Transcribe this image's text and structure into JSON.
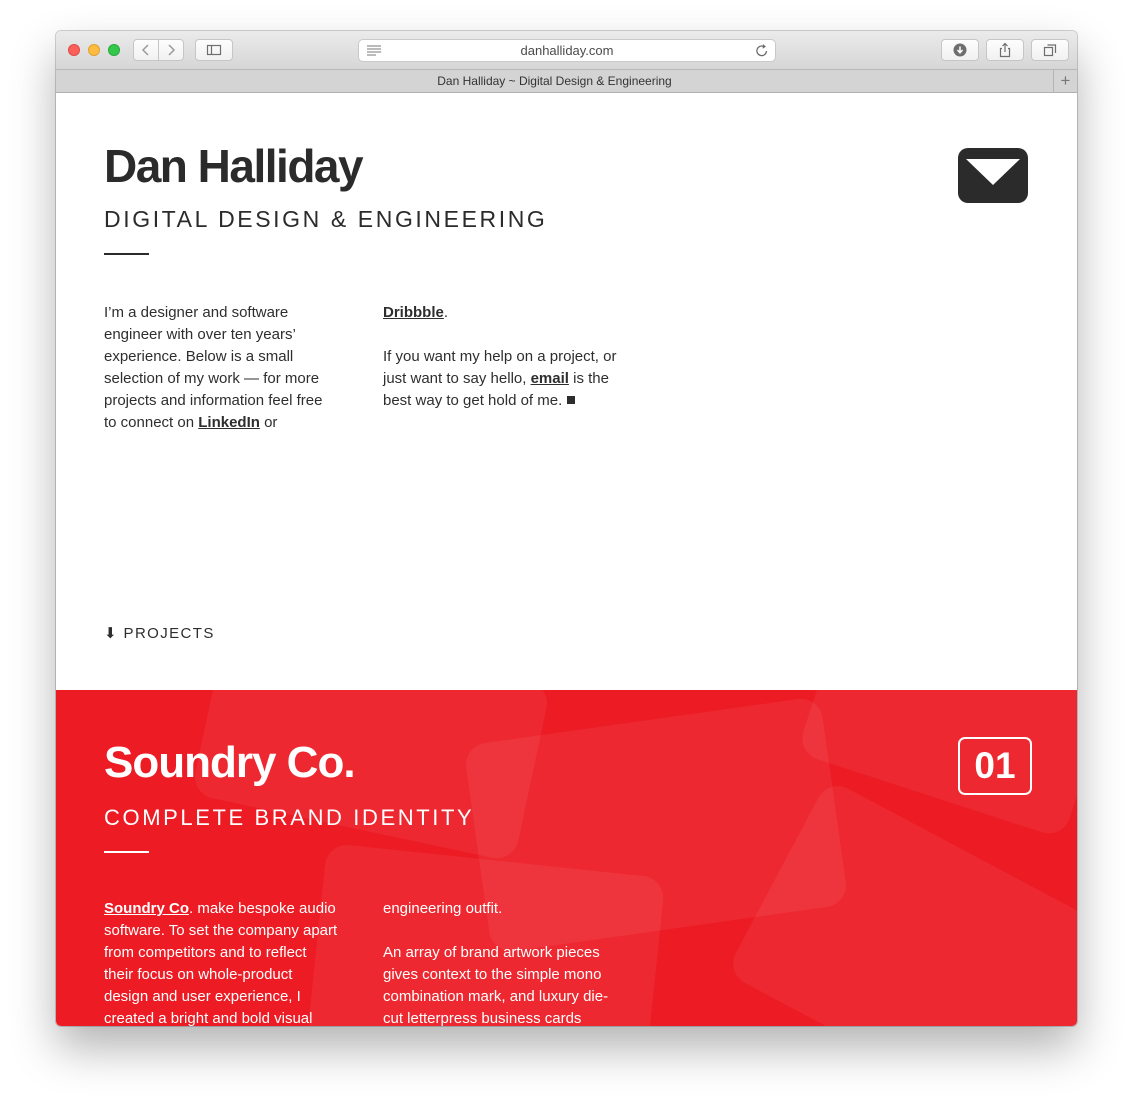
{
  "browser": {
    "url": "danhalliday.com",
    "tab_title": "Dan Halliday ~ Digital Design & Engineering",
    "new_tab_label": "+"
  },
  "header": {
    "name": "Dan Halliday",
    "subtitle": "DIGITAL DESIGN & ENGINEERING"
  },
  "intro": {
    "col1_text": "I’m a designer and software engineer with over ten years’ experience. Below is a small selection of my work — for more projects and information feel free to connect on ",
    "linkedin_label": "LinkedIn",
    "or_text": " or",
    "dribbble_label": "Dribbble",
    "period": ".",
    "contact_pre": "If you want my help on a project, or just want to say hello, ",
    "email_label": "email",
    "contact_post": " is the best way to get hold of me."
  },
  "projects_link": {
    "arrow": "⬇",
    "label": "PROJECTS"
  },
  "project": {
    "number": "01",
    "title": "Soundry Co.",
    "subtitle": "COMPLETE BRAND IDENTITY",
    "link_label": "Soundry Co",
    "col1_text": ". make bespoke audio software. To set the company apart from competitors and to reflect their focus on whole-product design and user experience, I created a bright and bold visual",
    "col2_para1": "engineering outfit.",
    "col2_para2": "An array of brand artwork pieces gives context to the simple mono combination mark, and luxury die-cut letterpress business cards"
  },
  "colors": {
    "accent_red": "#ec1b24",
    "text_dark": "#2b2b2b"
  },
  "icons": [
    "back-icon",
    "forward-icon",
    "sidebar-icon",
    "reader-icon",
    "reload-icon",
    "download-icon",
    "share-icon",
    "tabs-icon",
    "mail-icon",
    "arrow-down-icon"
  ]
}
